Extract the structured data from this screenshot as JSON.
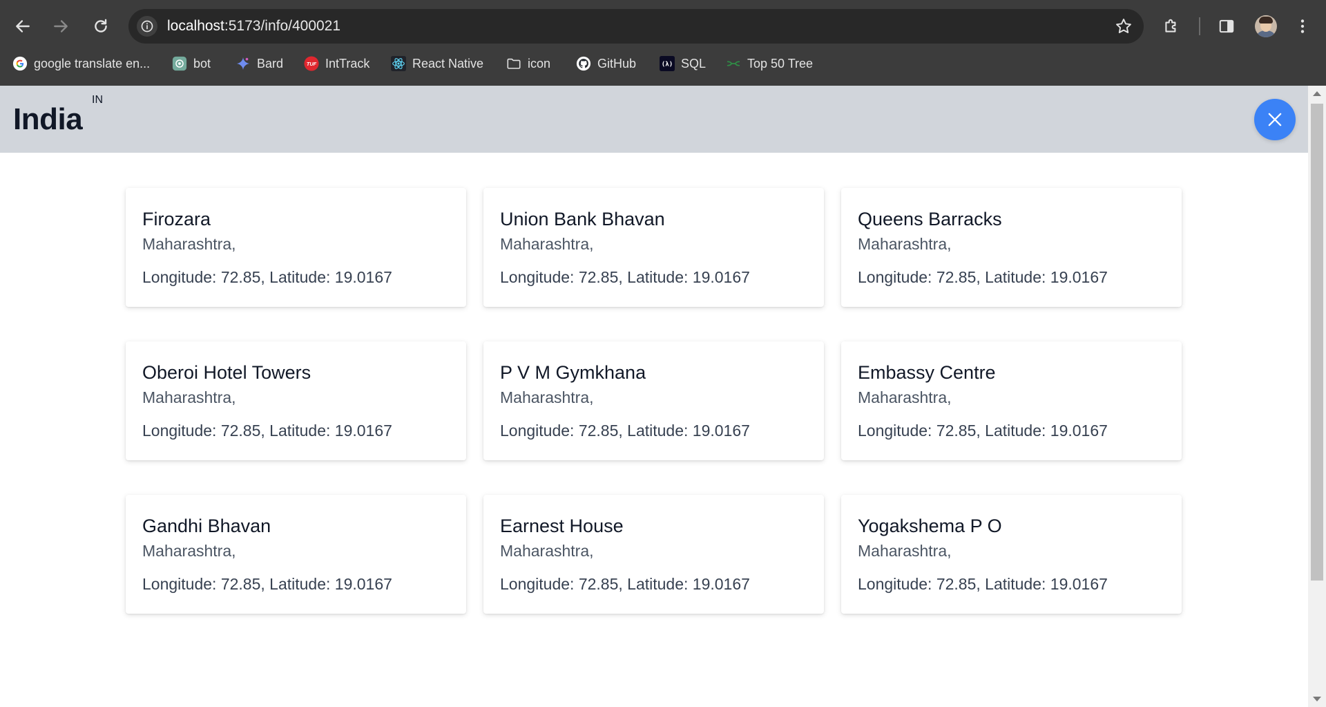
{
  "browser": {
    "url_host": "localhost",
    "url_path": ":5173/info/400021",
    "bookmarks": [
      {
        "label": "google translate en...",
        "icon": "google-icon"
      },
      {
        "label": "bot",
        "icon": "chatgpt-icon"
      },
      {
        "label": "Bard",
        "icon": "bard-sparkle-icon"
      },
      {
        "label": "IntTrack",
        "icon": "tuf-icon"
      },
      {
        "label": "React Native",
        "icon": "react-icon"
      },
      {
        "label": "icon",
        "icon": "folder-icon"
      },
      {
        "label": "GitHub",
        "icon": "github-icon"
      },
      {
        "label": "SQL",
        "icon": "sql-icon"
      },
      {
        "label": "Top 50 Tree",
        "icon": "tree-icon"
      }
    ]
  },
  "header": {
    "country": "India",
    "country_code": "IN",
    "accent_color": "#3b82f6"
  },
  "locations": [
    {
      "name": "Firozara",
      "state": "Maharashtra,",
      "coords": "Longitude: 72.85, Latitude: 19.0167"
    },
    {
      "name": "Union Bank Bhavan",
      "state": "Maharashtra,",
      "coords": "Longitude: 72.85, Latitude: 19.0167"
    },
    {
      "name": "Queens Barracks",
      "state": "Maharashtra,",
      "coords": "Longitude: 72.85, Latitude: 19.0167"
    },
    {
      "name": "Oberoi Hotel Towers",
      "state": "Maharashtra,",
      "coords": "Longitude: 72.85, Latitude: 19.0167"
    },
    {
      "name": "P V M Gymkhana",
      "state": "Maharashtra,",
      "coords": "Longitude: 72.85, Latitude: 19.0167"
    },
    {
      "name": "Embassy Centre",
      "state": "Maharashtra,",
      "coords": "Longitude: 72.85, Latitude: 19.0167"
    },
    {
      "name": "Gandhi Bhavan",
      "state": "Maharashtra,",
      "coords": "Longitude: 72.85, Latitude: 19.0167"
    },
    {
      "name": "Earnest House",
      "state": "Maharashtra,",
      "coords": "Longitude: 72.85, Latitude: 19.0167"
    },
    {
      "name": "Yogakshema P O",
      "state": "Maharashtra,",
      "coords": "Longitude: 72.85, Latitude: 19.0167"
    }
  ]
}
